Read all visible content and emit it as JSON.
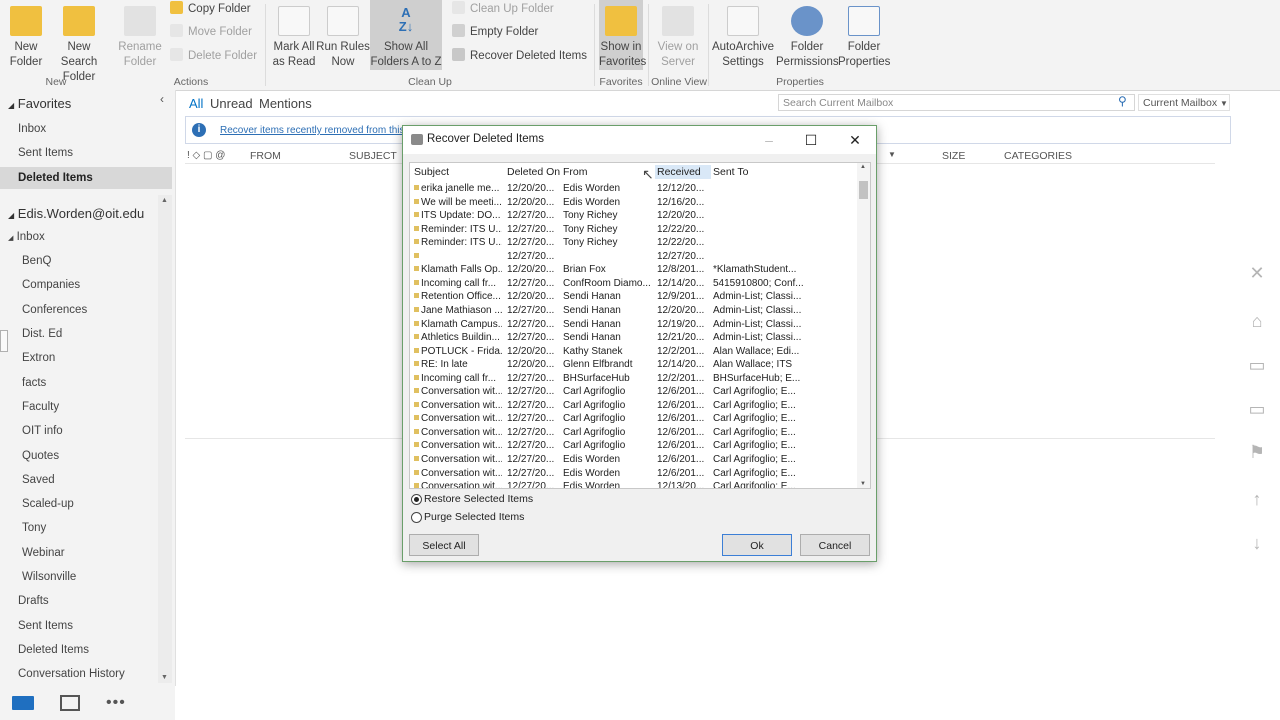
{
  "ribbon": {
    "new_folder": "New\nFolder",
    "new_search_folder": "New Search\nFolder",
    "rename_folder": "Rename\nFolder",
    "copy_folder": "Copy Folder",
    "move_folder": "Move Folder",
    "delete_folder": "Delete Folder",
    "mark_all_read": "Mark All\nas Read",
    "run_rules": "Run Rules\nNow",
    "show_all_folders": "Show All\nFolders A to Z",
    "clean_up_folder": "Clean Up Folder",
    "empty_folder": "Empty Folder",
    "recover_deleted": "Recover Deleted Items",
    "show_in_favorites": "Show in\nFavorites",
    "view_on_server": "View on\nServer",
    "autoarchive": "AutoArchive\nSettings",
    "folder_permissions": "Folder\nPermissions",
    "folder_properties": "Folder\nProperties",
    "groups": {
      "new": "New",
      "actions": "Actions",
      "cleanup": "Clean Up",
      "favorites": "Favorites",
      "online_view": "Online View",
      "properties": "Properties"
    }
  },
  "nav": {
    "favorites_header": "Favorites",
    "favorites": [
      "Inbox",
      "Sent Items",
      "Deleted Items"
    ],
    "account": "Edis.Worden@oit.edu",
    "inbox": "Inbox",
    "inbox_subfolders": [
      "BenQ",
      "Companies",
      "Conferences",
      "Dist. Ed",
      "Extron",
      "facts",
      "Faculty",
      "OIT info",
      "Quotes",
      "Saved",
      "Scaled-up",
      "Tony",
      "Webinar",
      "Wilsonville"
    ],
    "folders": [
      "Drafts",
      "Sent Items",
      "Deleted Items",
      "Conversation History"
    ]
  },
  "main": {
    "filters": [
      "All",
      "Unread",
      "Mentions"
    ],
    "search_placeholder": "Search Current Mailbox",
    "scope": "Current Mailbox",
    "info_text": "Recover items recently removed from this",
    "columns": [
      "FROM",
      "SUBJECT",
      "SIZE",
      "CATEGORIES"
    ]
  },
  "dialog": {
    "title": "Recover Deleted Items",
    "headers": [
      "Subject",
      "Deleted On",
      "From",
      "Received",
      "Sent To"
    ],
    "rows": [
      [
        "erika janelle me...",
        "12/20/20...",
        "Edis Worden",
        "12/12/20...",
        ""
      ],
      [
        "We will be meeti...",
        "12/20/20...",
        "Edis Worden",
        "12/16/20...",
        ""
      ],
      [
        "ITS Update: DO...",
        "12/27/20...",
        "Tony Richey",
        "12/20/20...",
        ""
      ],
      [
        "Reminder: ITS U...",
        "12/27/20...",
        "Tony Richey",
        "12/22/20...",
        ""
      ],
      [
        "Reminder: ITS U...",
        "12/27/20...",
        "Tony Richey",
        "12/22/20...",
        ""
      ],
      [
        "",
        "12/27/20...",
        "",
        "12/27/20...",
        ""
      ],
      [
        "Klamath Falls Op...",
        "12/20/20...",
        "Brian Fox",
        "12/8/201...",
        "*KlamathStudent..."
      ],
      [
        "Incoming call fr...",
        "12/27/20...",
        "ConfRoom Diamo...",
        "12/14/20...",
        "5415910800; Conf..."
      ],
      [
        "Retention Office...",
        "12/20/20...",
        "Sendi Hanan",
        "12/9/201...",
        "Admin-List; Classi..."
      ],
      [
        "Jane Mathiason ...",
        "12/27/20...",
        "Sendi Hanan",
        "12/20/20...",
        "Admin-List; Classi..."
      ],
      [
        "Klamath Campus...",
        "12/27/20...",
        "Sendi Hanan",
        "12/19/20...",
        "Admin-List; Classi..."
      ],
      [
        "Athletics Buildin...",
        "12/27/20...",
        "Sendi Hanan",
        "12/21/20...",
        "Admin-List; Classi..."
      ],
      [
        "POTLUCK - Frida...",
        "12/20/20...",
        "Kathy Stanek",
        "12/2/201...",
        "Alan Wallace; Edi..."
      ],
      [
        "RE: In late",
        "12/20/20...",
        "Glenn Elfbrandt",
        "12/14/20...",
        "Alan Wallace; ITS"
      ],
      [
        "Incoming call fr...",
        "12/27/20...",
        "BHSurfaceHub",
        "12/2/201...",
        "BHSurfaceHub; E..."
      ],
      [
        "Conversation wit...",
        "12/27/20...",
        "Carl Agrifoglio",
        "12/6/201...",
        "Carl Agrifoglio; E..."
      ],
      [
        "Conversation wit...",
        "12/27/20...",
        "Carl Agrifoglio",
        "12/6/201...",
        "Carl Agrifoglio; E..."
      ],
      [
        "Conversation wit...",
        "12/27/20...",
        "Carl Agrifoglio",
        "12/6/201...",
        "Carl Agrifoglio; E..."
      ],
      [
        "Conversation wit...",
        "12/27/20...",
        "Carl Agrifoglio",
        "12/6/201...",
        "Carl Agrifoglio; E..."
      ],
      [
        "Conversation wit...",
        "12/27/20...",
        "Carl Agrifoglio",
        "12/6/201...",
        "Carl Agrifoglio; E..."
      ],
      [
        "Conversation wit...",
        "12/27/20...",
        "Edis Worden",
        "12/6/201...",
        "Carl Agrifoglio; E..."
      ],
      [
        "Conversation wit...",
        "12/27/20...",
        "Edis Worden",
        "12/6/201...",
        "Carl Agrifoglio; E..."
      ],
      [
        "Conversation wit...",
        "12/27/20...",
        "Edis Worden",
        "12/13/20...",
        "Carl Agrifoglio; E..."
      ]
    ],
    "restore_label": "Restore Selected Items",
    "purge_label": "Purge Selected Items",
    "select_all": "Select All",
    "ok": "Ok",
    "cancel": "Cancel"
  },
  "colors": {
    "accent": "#0072c6",
    "folder": "#f0c040"
  }
}
